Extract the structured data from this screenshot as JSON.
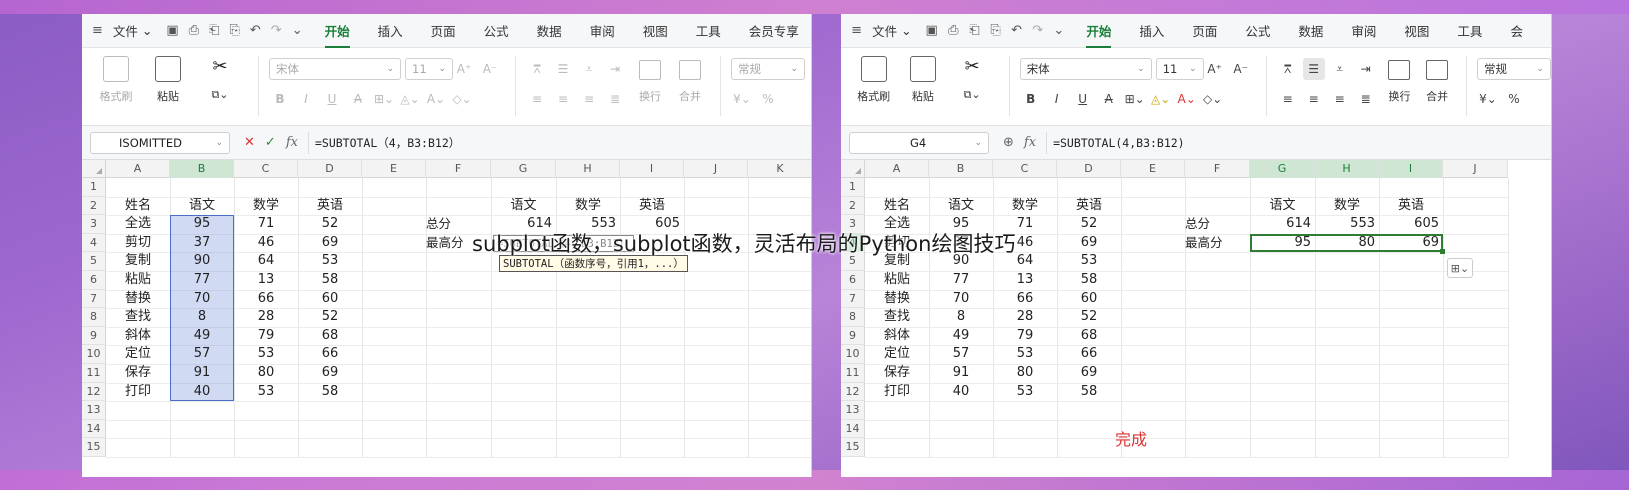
{
  "caption": "subplot函数，subplot函数，灵活布局的Python绘图技巧",
  "left": {
    "menu": {
      "file": "文件",
      "tabs": [
        "开始",
        "插入",
        "页面",
        "公式",
        "数据",
        "审阅",
        "视图",
        "工具",
        "会员专享"
      ]
    },
    "ribbon": {
      "format_painter": "格式刷",
      "paste": "粘贴",
      "font_name": "宋体",
      "font_size": "11",
      "wrap": "换行",
      "merge": "合并",
      "number_format": "常规",
      "currency": "¥",
      "percent": "%"
    },
    "namebox": "ISOMITTED",
    "formula": "=SUBTOTAL（4，B3:B12）",
    "col_headers": [
      "A",
      "B",
      "C",
      "D",
      "E",
      "F",
      "G",
      "H",
      "I",
      "J",
      "K"
    ],
    "row_headers": [
      "1",
      "2",
      "3",
      "4",
      "5",
      "6",
      "7",
      "8",
      "9",
      "10",
      "11",
      "12",
      "13",
      "14",
      "15"
    ],
    "table": {
      "headers": [
        "姓名",
        "语文",
        "数学",
        "英语"
      ],
      "rows": [
        [
          "全选",
          "95",
          "71",
          "52"
        ],
        [
          "剪切",
          "37",
          "46",
          "69"
        ],
        [
          "复制",
          "90",
          "64",
          "53"
        ],
        [
          "粘贴",
          "77",
          "13",
          "58"
        ],
        [
          "替换",
          "70",
          "66",
          "60"
        ],
        [
          "查找",
          "8",
          "28",
          "52"
        ],
        [
          "斜体",
          "49",
          "79",
          "68"
        ],
        [
          "定位",
          "57",
          "53",
          "66"
        ],
        [
          "保存",
          "91",
          "80",
          "69"
        ],
        [
          "打印",
          "40",
          "53",
          "58"
        ]
      ]
    },
    "summary": {
      "headers": [
        "语文",
        "数学",
        "英语"
      ],
      "total_label": "总分",
      "total": [
        "614",
        "553",
        "605"
      ],
      "max_label": "最高分"
    },
    "editing_text": "=SUBTOTAL（4，B3:B12）",
    "hint_text": "SUBTOTAL（函数序号，引用1，...）"
  },
  "right": {
    "menu": {
      "file": "文件",
      "tabs": [
        "开始",
        "插入",
        "页面",
        "公式",
        "数据",
        "审阅",
        "视图",
        "工具",
        "会"
      ]
    },
    "ribbon": {
      "format_painter": "格式刷",
      "paste": "粘贴",
      "font_name": "宋体",
      "font_size": "11",
      "wrap": "换行",
      "merge": "合并",
      "number_format": "常规",
      "currency": "¥",
      "percent": "%"
    },
    "namebox": "G4",
    "formula": "=SUBTOTAL(4,B3:B12)",
    "col_headers": [
      "A",
      "B",
      "C",
      "D",
      "E",
      "F",
      "G",
      "H",
      "I",
      "J"
    ],
    "row_headers": [
      "1",
      "2",
      "3",
      "4",
      "5",
      "6",
      "7",
      "8",
      "9",
      "10",
      "11",
      "12",
      "13",
      "14",
      "15"
    ],
    "table": {
      "headers": [
        "姓名",
        "语文",
        "数学",
        "英语"
      ],
      "rows": [
        [
          "全选",
          "95",
          "71",
          "52"
        ],
        [
          "剪切",
          "37",
          "46",
          "69"
        ],
        [
          "复制",
          "90",
          "64",
          "53"
        ],
        [
          "粘贴",
          "77",
          "13",
          "58"
        ],
        [
          "替换",
          "70",
          "66",
          "60"
        ],
        [
          "查找",
          "8",
          "28",
          "52"
        ],
        [
          "斜体",
          "49",
          "79",
          "68"
        ],
        [
          "定位",
          "57",
          "53",
          "66"
        ],
        [
          "保存",
          "91",
          "80",
          "69"
        ],
        [
          "打印",
          "40",
          "53",
          "58"
        ]
      ]
    },
    "summary": {
      "headers": [
        "语文",
        "数学",
        "英语"
      ],
      "total_label": "总分",
      "total": [
        "614",
        "553",
        "605"
      ],
      "max_label": "最高分",
      "max": [
        "95",
        "80",
        "69"
      ]
    },
    "done_label": "完成"
  }
}
